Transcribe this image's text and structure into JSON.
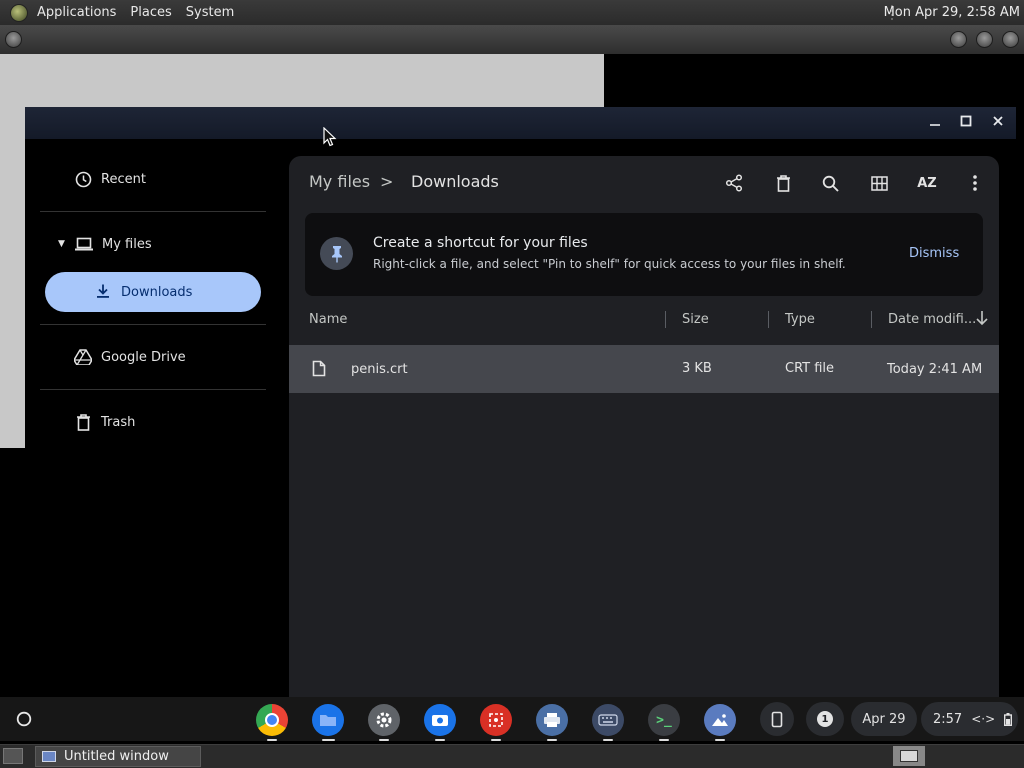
{
  "top_panel": {
    "menus": [
      "Applications",
      "Places",
      "System"
    ],
    "clock": "Mon Apr 29,  2:58 AM"
  },
  "window": {
    "buttons": {
      "minimize": "–",
      "maximize": "□",
      "close": "✕"
    }
  },
  "sidebar": {
    "recent": "Recent",
    "my_files": "My files",
    "downloads": "Downloads",
    "google_drive": "Google Drive",
    "trash": "Trash"
  },
  "breadcrumb": {
    "root": "My files",
    "separator": ">",
    "current": "Downloads"
  },
  "toolbar": {
    "icons": [
      "share-icon",
      "delete-icon",
      "search-icon",
      "grid-view-icon",
      "sort-az-icon",
      "more-icon"
    ],
    "sort_label": "AZ"
  },
  "banner": {
    "title": "Create a shortcut for your files",
    "text": "Right-click a file, and select \"Pin to shelf\" for quick access to your files in shelf.",
    "dismiss": "Dismiss"
  },
  "table": {
    "columns": {
      "name": "Name",
      "size": "Size",
      "type": "Type",
      "date": "Date modifi..."
    },
    "rows": [
      {
        "name": "penis.crt",
        "size": "3 KB",
        "type": "CRT file",
        "date": "Today 2:41 AM"
      }
    ]
  },
  "shelf": {
    "apps": [
      "chrome",
      "files",
      "settings",
      "camera",
      "screencast",
      "printer",
      "keyboard",
      "terminal",
      "gallery"
    ],
    "notification_count": "1",
    "date": "Apr 29",
    "time": "2:57"
  },
  "taskbar": {
    "window_title": "Untitled window"
  },
  "colors": {
    "accent": "#a8c7fa",
    "panel": "#1f2024",
    "selected_row": "#45474d"
  }
}
